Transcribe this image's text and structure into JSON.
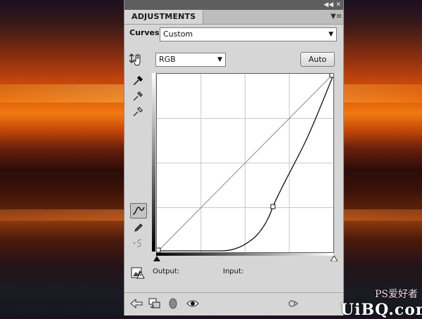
{
  "panel": {
    "tab_label": "ADJUSTMENTS",
    "adjustment_name": "Curves",
    "preset": {
      "selected": "Custom"
    },
    "channel": {
      "selected": "RGB"
    },
    "auto_label": "Auto",
    "output_label": "Output:",
    "input_label": "Input:"
  },
  "watermark": {
    "text": "PS爱好者",
    "logo": "UiBQ.com"
  }
}
